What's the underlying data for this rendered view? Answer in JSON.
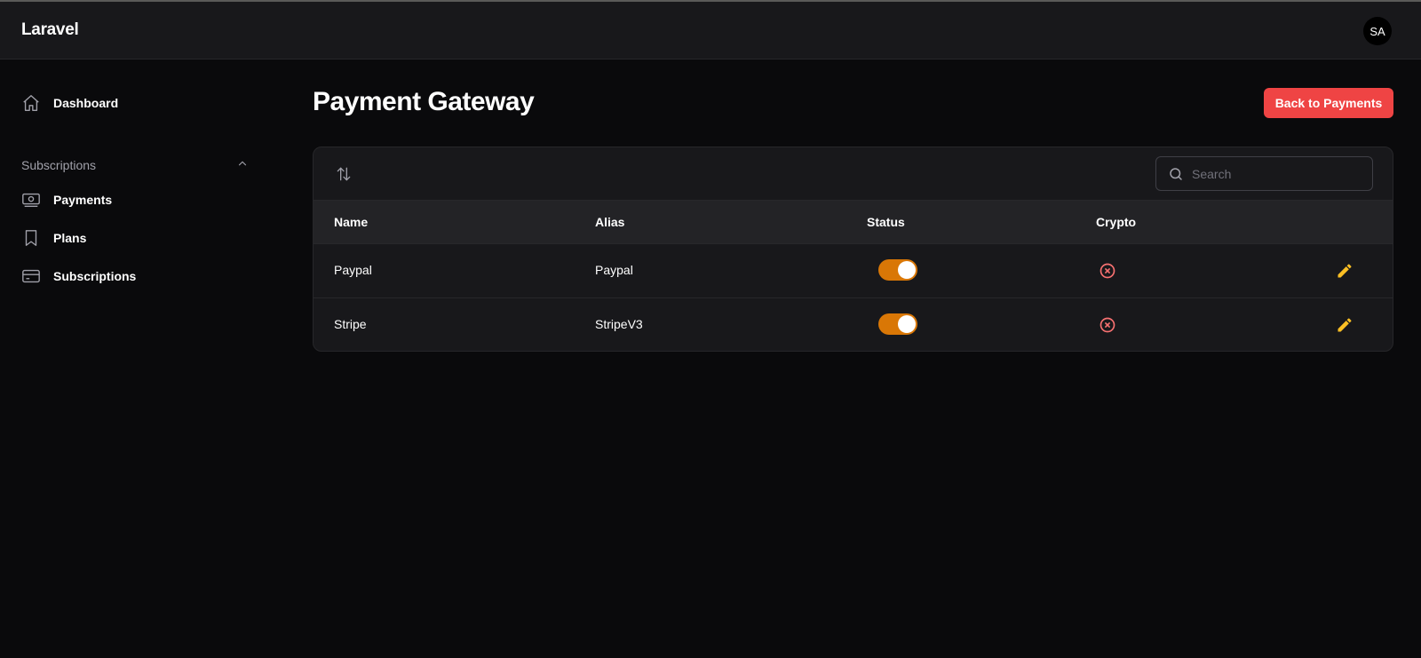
{
  "app": {
    "brand": "Laravel",
    "avatar_initials": "SA"
  },
  "sidebar": {
    "items": [
      {
        "label": "Dashboard",
        "icon": "home-icon"
      }
    ],
    "group": {
      "label": "Subscriptions",
      "expanded": true,
      "items": [
        {
          "label": "Payments",
          "icon": "banknote-icon"
        },
        {
          "label": "Plans",
          "icon": "bookmark-icon"
        },
        {
          "label": "Subscriptions",
          "icon": "credit-card-icon"
        }
      ]
    }
  },
  "page": {
    "title": "Payment Gateway",
    "back_button": "Back to Payments"
  },
  "table": {
    "search_placeholder": "Search",
    "columns": [
      "Name",
      "Alias",
      "Status",
      "Crypto"
    ],
    "rows": [
      {
        "name": "Paypal",
        "alias": "Paypal",
        "status": true,
        "crypto": false
      },
      {
        "name": "Stripe",
        "alias": "StripeV3",
        "status": true,
        "crypto": false
      }
    ]
  },
  "colors": {
    "accent_danger": "#ef4444",
    "toggle_on": "#d97706",
    "crypto_false": "#f87171",
    "edit_icon": "#fbbf24"
  }
}
